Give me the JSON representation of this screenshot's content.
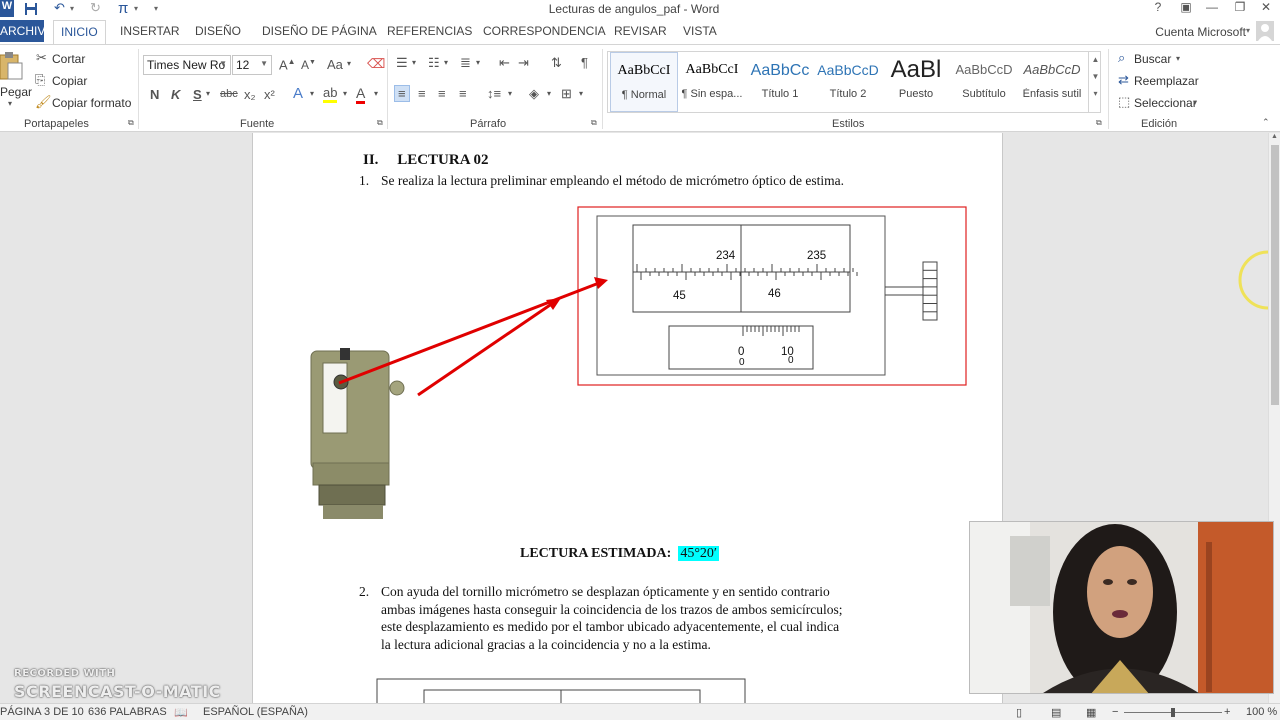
{
  "window": {
    "title": "Lecturas de angulos_paf - Word",
    "account": "Cuenta Microsoft",
    "help": "?"
  },
  "tabs": [
    "ARCHIVO",
    "INICIO",
    "INSERTAR",
    "DISEÑO",
    "DISEÑO DE PÁGINA",
    "REFERENCIAS",
    "CORRESPONDENCIA",
    "REVISAR",
    "VISTA"
  ],
  "clipboard": {
    "paste": "Pegar",
    "cut": "Cortar",
    "copy": "Copiar",
    "format_painter": "Copiar formato",
    "label": "Portapapeles"
  },
  "font": {
    "name": "Times New Ro",
    "size": "12",
    "label": "Fuente",
    "change_case": "Aa",
    "bold": "N",
    "italic": "K",
    "underline": "S",
    "strike": "abc",
    "sub": "x₂",
    "sup": "x²"
  },
  "paragraph": {
    "label": "Párrafo",
    "pilcrow": "¶"
  },
  "styles": {
    "label": "Estilos",
    "items": [
      {
        "preview": "AaBbCcI",
        "name": "¶ Normal"
      },
      {
        "preview": "AaBbCcI",
        "name": "¶ Sin espa..."
      },
      {
        "preview": "AaBbCc",
        "name": "Título 1"
      },
      {
        "preview": "AaBbCcD",
        "name": "Título 2"
      },
      {
        "preview": "AaBl",
        "name": "Puesto"
      },
      {
        "preview": "AaBbCcD",
        "name": "Subtítulo"
      },
      {
        "preview": "AaBbCcD",
        "name": "Énfasis sutil"
      }
    ]
  },
  "editing": {
    "find": "Buscar",
    "replace": "Reemplazar",
    "select": "Seleccionar",
    "label": "Edición"
  },
  "document": {
    "section_number": "II.",
    "section_title": "LECTURA 02",
    "item1_number": "1.",
    "item1_text": "Se realiza la lectura preliminar empleando el método de micrómetro óptico de estima.",
    "diagram": {
      "scale_label_234": "234",
      "scale_label_235": "235",
      "scale_label_45": "45",
      "scale_label_46": "46",
      "micro_label_0": "0",
      "micro_label_10": "10",
      "micro_sub_0a": "0",
      "micro_sub_0b": "0"
    },
    "estimate_label": "LECTURA ESTIMADA:",
    "estimate_value": "45°20′",
    "item2_number": "2.",
    "item2_lines": [
      "Con ayuda del tornillo micrómetro se desplazan ópticamente y en sentido contrario",
      "ambas imágenes hasta conseguir la coincidencia de los trazos de ambos semicírculos;",
      "este desplazamiento es medido por el tambor ubicado adyacentemente, el cual indica",
      "la lectura adicional gracias a la coincidencia y no a la estima."
    ]
  },
  "statusbar": {
    "page": "PÁGINA 3 DE 10",
    "words": "636 PALABRAS",
    "language": "ESPAÑOL (ESPAÑA)",
    "zoom": "100 %"
  },
  "watermark": {
    "top": "RECORDED WITH",
    "bottom": "SCREENCAST-O-MATIC"
  }
}
